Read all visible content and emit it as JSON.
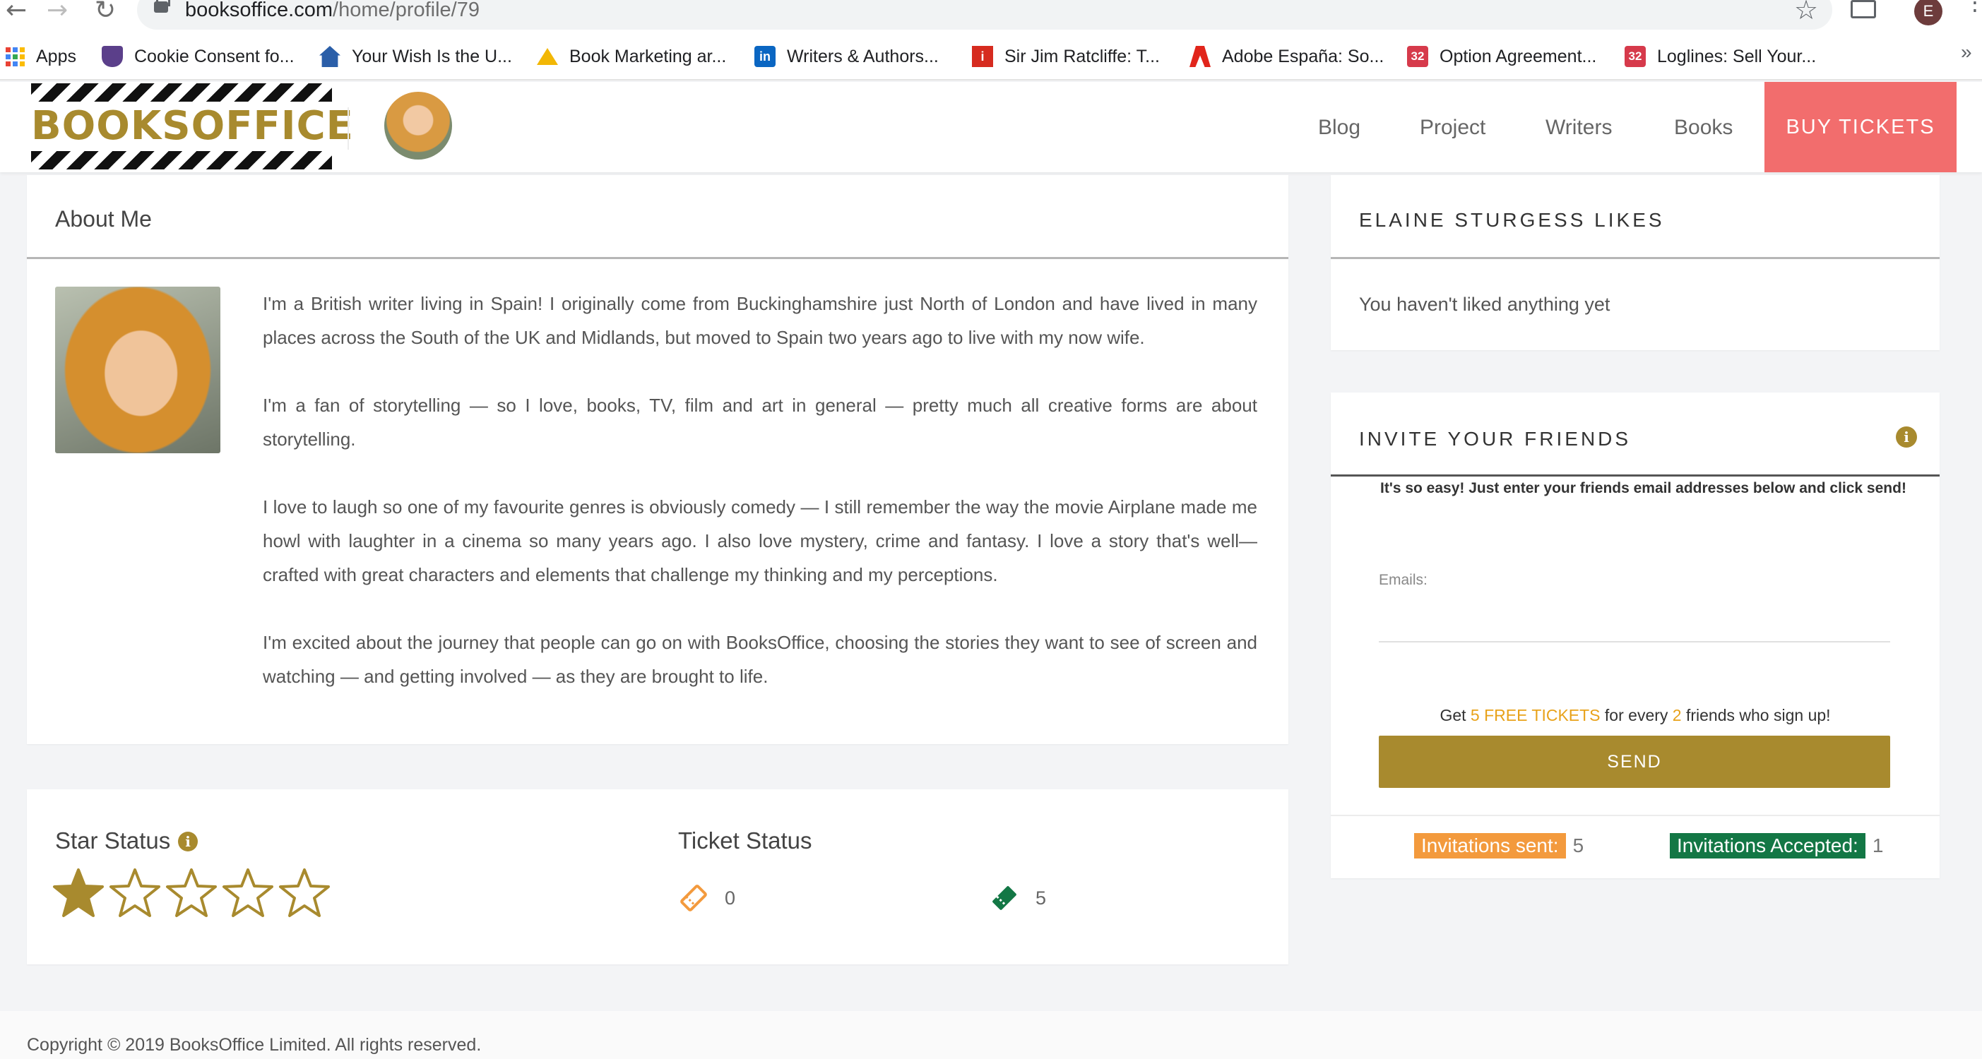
{
  "browser": {
    "url_host": "booksoffice.com",
    "url_path": "/home/profile/79",
    "profile_initial": "E",
    "bookmarks": [
      {
        "label": "Apps",
        "icon": "apps-grid-icon"
      },
      {
        "label": "Cookie Consent fo...",
        "icon": "shield-icon",
        "color": "#5b3f8a"
      },
      {
        "label": "Your Wish Is the U...",
        "icon": "house-icon",
        "color": "#2a5ea8"
      },
      {
        "label": "Book Marketing ar...",
        "icon": "triangle-logo-icon",
        "color": "#f2b705"
      },
      {
        "label": "Writers & Authors...",
        "icon": "linkedin-icon",
        "color": "#0a66c2"
      },
      {
        "label": "Sir Jim Ratcliffe: T...",
        "icon": "independent-icon",
        "color": "#d62b1f"
      },
      {
        "label": "Adobe España: So...",
        "icon": "adobe-icon",
        "color": "#e1251b"
      },
      {
        "label": "Option Agreement...",
        "icon": "calendar-32-icon",
        "color": "#d63a4b"
      },
      {
        "label": "Loglines: Sell Your...",
        "icon": "calendar-32-icon",
        "color": "#d63a4b"
      }
    ],
    "more": "»"
  },
  "header": {
    "logo_text": "BOOKSOFFICE",
    "nav": [
      "Blog",
      "Project",
      "Writers",
      "Books"
    ],
    "cta": "BUY TICKETS",
    "colors": {
      "gold": "#a88a2e",
      "cta": "#f26d6d"
    }
  },
  "about": {
    "title": "About Me",
    "paragraphs": [
      "I'm a British writer living in Spain! I originally come from Buckinghamshire just North of London and have lived in many places across the South of the UK and Midlands, but moved to Spain two years ago to live with my now wife.",
      "I'm a fan of storytelling — so I love, books, TV, film and art in general — pretty much all creative forms are about storytelling.",
      "I love to laugh so one of my favourite genres is obviously comedy — I still remember the way the movie Airplane made me howl with laughter in a cinema so many years ago. I also love mystery, crime and fantasy. I love a story that's well—crafted with great characters and elements that challenge my thinking and my perceptions.",
      "I'm excited about the journey that people can go on with BooksOffice, choosing the stories they want to see of screen and watching — and getting involved — as they are brought to life."
    ]
  },
  "status": {
    "star_title": "Star Status",
    "stars_filled": 1,
    "stars_total": 5,
    "ticket_title": "Ticket Status",
    "tickets_orange": "0",
    "tickets_green": "5"
  },
  "likes": {
    "title": "ELAINE STURGESS LIKES",
    "empty": "You haven't liked anything yet"
  },
  "invite": {
    "title": "INVITE YOUR FRIENDS",
    "subtitle": "It's so easy! Just enter your friends email addresses below and click send!",
    "emails_label": "Emails:",
    "emails_value": "",
    "free_prefix": "Get ",
    "free_highlight": "5 FREE TICKETS",
    "free_middle": " for every ",
    "free_count": "2",
    "free_suffix": " friends who sign up!",
    "send": "SEND",
    "sent_label": "Invitations sent:",
    "sent_value": "5",
    "accepted_label": "Invitations Accepted:",
    "accepted_value": "1"
  },
  "footer": {
    "copyright": "Copyright © 2019 BooksOffice Limited. All rights reserved."
  }
}
